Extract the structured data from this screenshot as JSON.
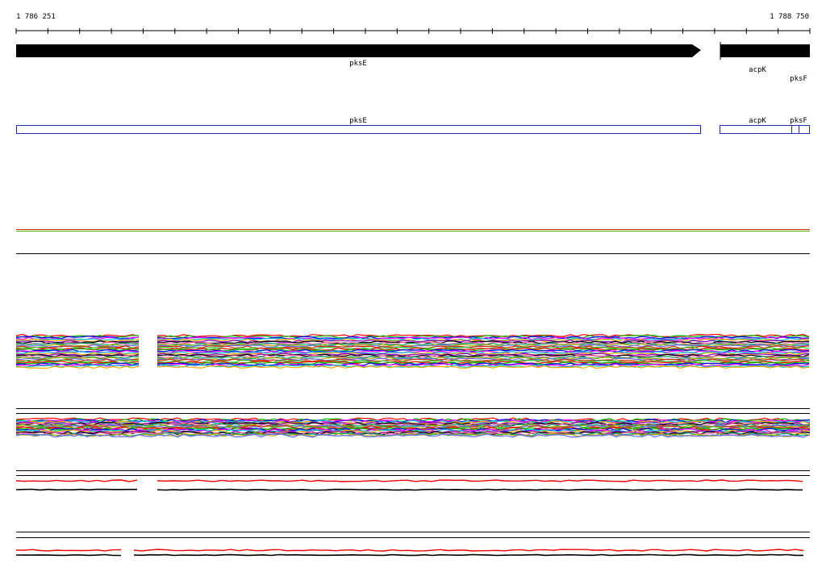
{
  "ruler": {
    "start_label": "1 786 251",
    "end_label": "1 788 750",
    "start": 1786251,
    "end": 1788750
  },
  "genes": [
    {
      "name": "pksE",
      "strand": "+"
    },
    {
      "name": "acpK",
      "strand": "+"
    },
    {
      "name": "pksF",
      "strand": "+"
    }
  ],
  "annotations": [
    {
      "name": "pksE"
    },
    {
      "name": "acpK"
    },
    {
      "name": "pksF"
    }
  ],
  "colors": {
    "gene": "#000000",
    "annotation_outline": "#1f2fb0",
    "palette": [
      "#ff0000",
      "#00bb00",
      "#0000ff",
      "#ff00ff",
      "#00cccc",
      "#ffaa00",
      "#8800cc",
      "#000000",
      "#ff66aa",
      "#00aa66",
      "#aaaa00",
      "#6666ff",
      "#cc3300",
      "#33cc33"
    ]
  }
}
